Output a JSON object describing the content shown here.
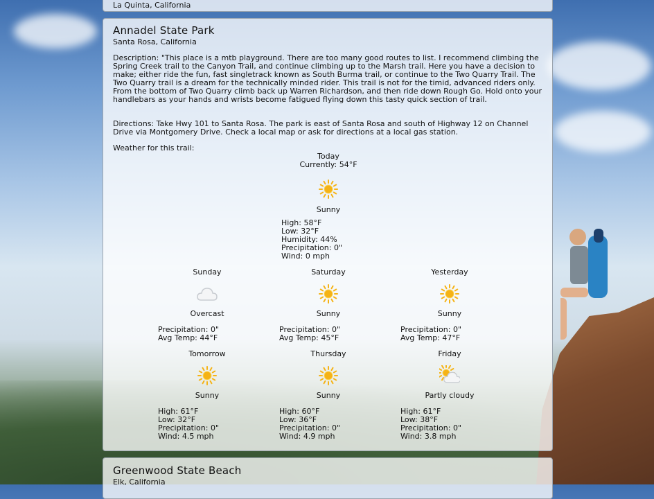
{
  "top_card": {
    "location": "La Quinta, California"
  },
  "trail": {
    "name": "Annadel State Park",
    "location": "Santa Rosa, California",
    "description": "Description: \"This place is a mtb playground. There are too many good routes to list. I recommend climbing the Spring Creek trail to the Canyon Trail, and continue climbing up to the Marsh trail. Here you have a decision to make; either ride the fun, fast singletrack known as South Burma trail, or continue to the Two Quarry Trail. The Two Quarry trail is a dream for the technically minded rider. This trail is not for the timid, advanced riders only. From the bottom of Two Quarry climb back up Warren Richardson, and then ride down Rough Go. Hold onto your handlebars as your hands and wrists become fatigued flying down this tasty quick section of trail.",
    "directions": "Directions: Take Hwy 101 to Santa Rosa. The park is east of Santa Rosa and south of Highway 12 on Channel Drive via Montgomery Drive. Check a local map or ask for directions at a local gas station.",
    "weather_label": "Weather for this trail:"
  },
  "today": {
    "title": "Today",
    "current": "Currently: 54°F",
    "icon": "sun-icon",
    "condition": "Sunny",
    "high": "High: 58°F",
    "low": "Low: 32°F",
    "humidity": "Humidity: 44%",
    "precip": "Precipitation: 0\"",
    "wind": "Wind: 0 mph"
  },
  "past_days": [
    {
      "title": "Sunday",
      "icon": "cloud-icon",
      "condition": "Overcast",
      "precip": "Precipitation: 0\"",
      "avg": "Avg Temp: 44°F"
    },
    {
      "title": "Saturday",
      "icon": "sun-icon",
      "condition": "Sunny",
      "precip": "Precipitation: 0\"",
      "avg": "Avg Temp: 45°F"
    },
    {
      "title": "Yesterday",
      "icon": "sun-icon",
      "condition": "Sunny",
      "precip": "Precipitation: 0\"",
      "avg": "Avg Temp: 47°F"
    }
  ],
  "future_days": [
    {
      "title": "Tomorrow",
      "icon": "sun-icon",
      "condition": "Sunny",
      "high": "High: 61°F",
      "low": "Low: 32°F",
      "precip": "Precipitation: 0\"",
      "wind": "Wind: 4.5 mph"
    },
    {
      "title": "Thursday",
      "icon": "sun-icon",
      "condition": "Sunny",
      "high": "High: 60°F",
      "low": "Low: 36°F",
      "precip": "Precipitation: 0\"",
      "wind": "Wind: 4.9 mph"
    },
    {
      "title": "Friday",
      "icon": "partly-cloudy-icon",
      "condition": "Partly cloudy",
      "high": "High: 61°F",
      "low": "Low: 38°F",
      "precip": "Precipitation: 0\"",
      "wind": "Wind: 3.8 mph"
    }
  ],
  "next_card": {
    "name": "Greenwood State Beach",
    "location": "Elk, California"
  },
  "colors": {
    "sun": "#f5b316",
    "cloud": "#c9cdd2",
    "card": "#ffffffc7"
  }
}
